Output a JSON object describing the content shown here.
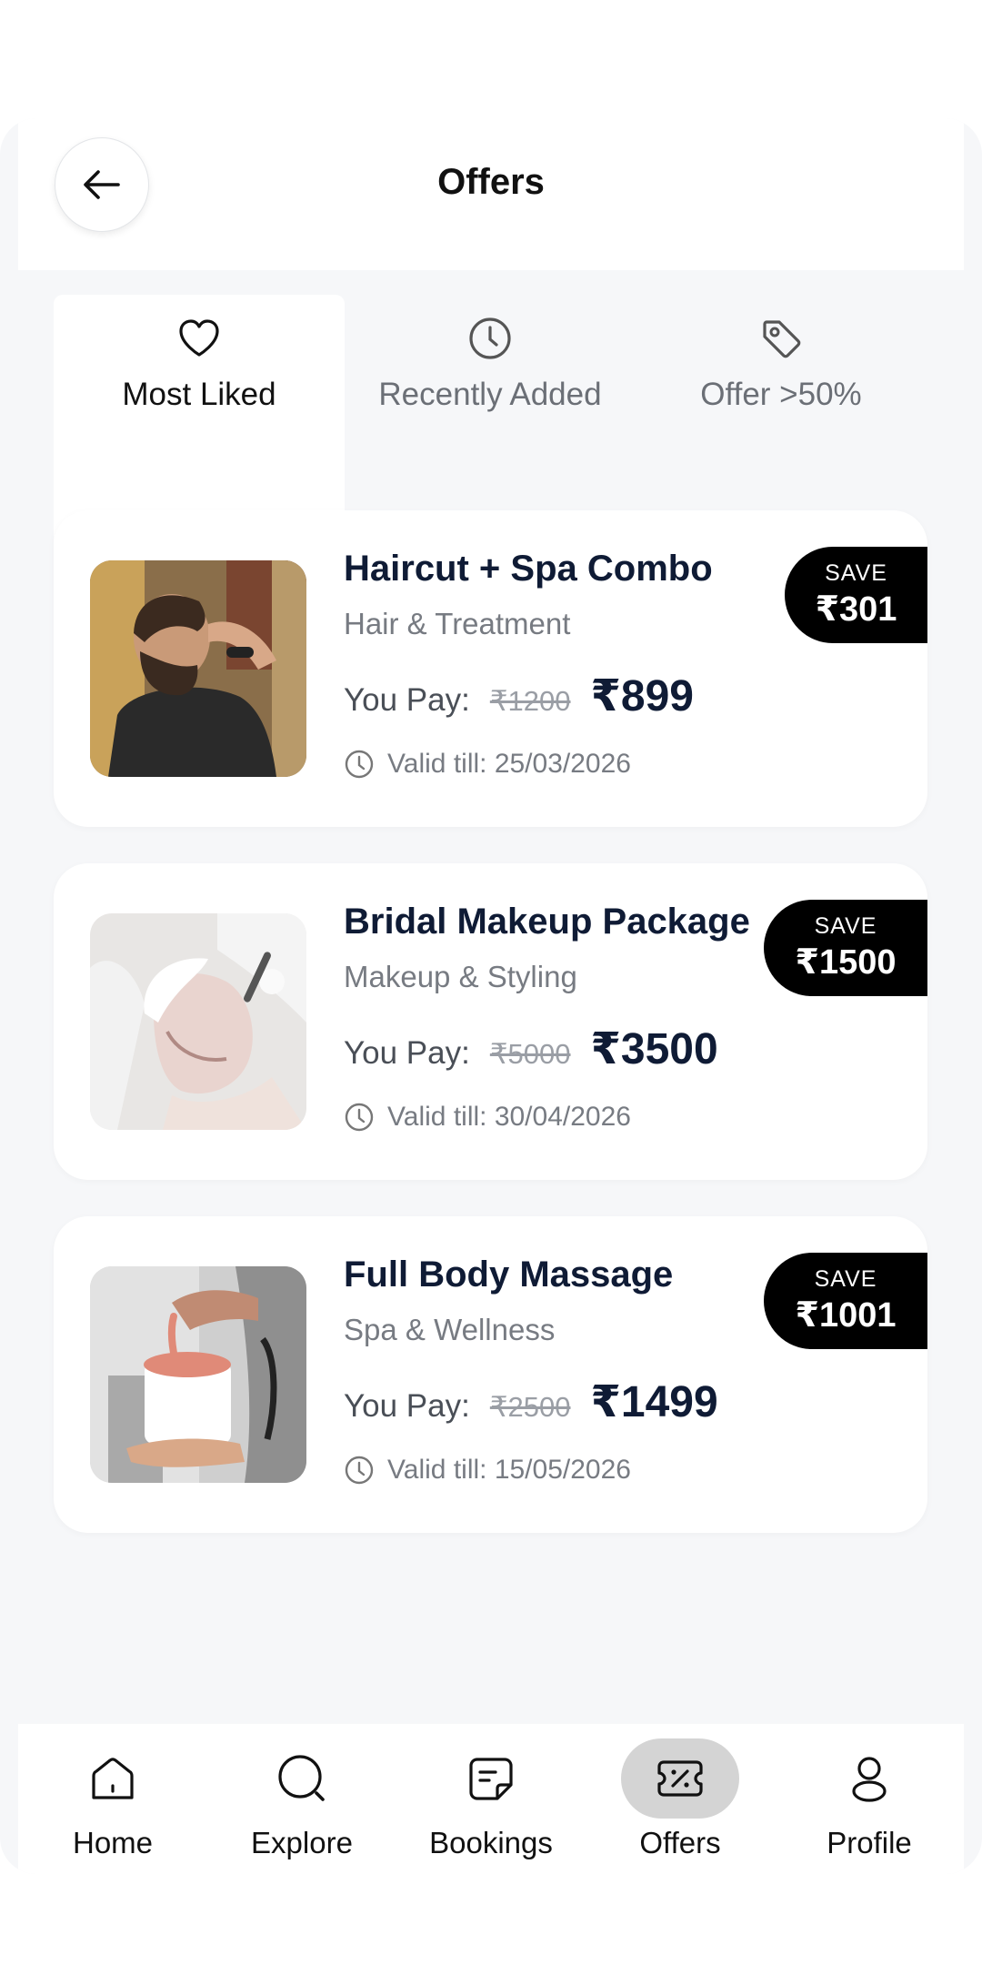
{
  "header": {
    "title": "Offers"
  },
  "tabs": [
    {
      "label": "Most Liked",
      "icon": "heart-icon",
      "active": true
    },
    {
      "label": "Recently Added",
      "icon": "clock-icon",
      "active": false
    },
    {
      "label": "Offer >50%",
      "icon": "tag-icon",
      "active": false
    }
  ],
  "offers": [
    {
      "title": "Haircut + Spa Combo",
      "category": "Hair & Treatment",
      "pay_label": "You Pay:",
      "original_price": "₹1200",
      "price": "₹899",
      "valid": "Valid till: 25/03/2026",
      "save_label": "SAVE",
      "save_amount": "₹301"
    },
    {
      "title": "Bridal Makeup Package",
      "category": "Makeup & Styling",
      "pay_label": "You Pay:",
      "original_price": "₹5000",
      "price": "₹3500",
      "valid": "Valid till: 30/04/2026",
      "save_label": "SAVE",
      "save_amount": "₹1500"
    },
    {
      "title": "Full Body Massage",
      "category": "Spa & Wellness",
      "pay_label": "You Pay:",
      "original_price": "₹2500",
      "price": "₹1499",
      "valid": "Valid till: 15/05/2026",
      "save_label": "SAVE",
      "save_amount": "₹1001"
    }
  ],
  "nav": [
    {
      "label": "Home",
      "icon": "home-icon",
      "active": false
    },
    {
      "label": "Explore",
      "icon": "search-icon",
      "active": false
    },
    {
      "label": "Bookings",
      "icon": "bookings-icon",
      "active": false
    },
    {
      "label": "Offers",
      "icon": "offers-icon",
      "active": true
    },
    {
      "label": "Profile",
      "icon": "profile-icon",
      "active": false
    }
  ],
  "colors": {
    "accent": "#000000",
    "title": "#0f1b35",
    "muted": "#777b82",
    "background": "#f6f7f9"
  }
}
